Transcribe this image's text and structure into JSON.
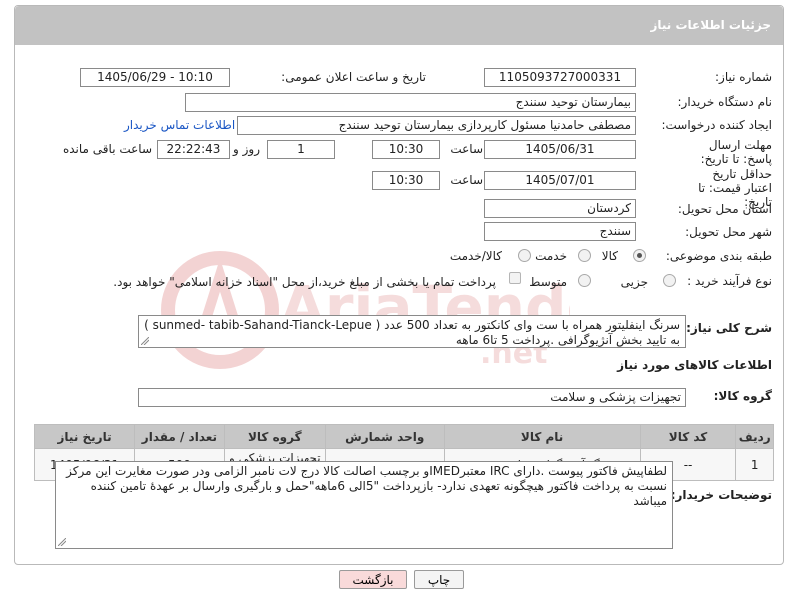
{
  "header": {
    "title": "جزئیات اطلاعات نیاز"
  },
  "fields": {
    "need_number_label": "شماره نیاز:",
    "need_number": "1105093727000331",
    "announce_label": "تاریخ و ساعت اعلان عمومی:",
    "announce_value": "1405/06/29 - 10:10",
    "buyer_org_label": "نام دستگاه خریدار:",
    "buyer_org": "بیمارستان توحید سنندج",
    "creator_label": "ایجاد کننده درخواست:",
    "creator": "مصطفی حامدنیا مسئول کارپردازی بیمارستان توحید سنندج",
    "contact_link": "اطلاعات تماس خریدار",
    "reply_deadline_label": "مهلت ارسال پاسخ: تا تاریخ:",
    "reply_date": "1405/06/31",
    "time_label": "ساعت",
    "reply_time": "10:30",
    "days_value": "1",
    "days_label": "روز و",
    "remaining_time": "22:22:43",
    "remaining_label": "ساعت باقی مانده",
    "price_validity_label": "حداقل تاریخ اعتبار قیمت: تا تاریخ:",
    "validity_date": "1405/07/01",
    "validity_time_label": "ساعت",
    "validity_time": "10:30",
    "province_label": "استان محل تحویل:",
    "province": "کردستان",
    "city_label": "شهر محل تحویل:",
    "city": "سنندج",
    "category_label": "طبقه بندی موضوعی:",
    "category_options": [
      "کالا",
      "خدمت",
      "کالا/خدمت"
    ],
    "category_selected": "کالا",
    "purchase_type_label": "نوع فرآیند خرید :",
    "purchase_options": [
      "جزیی",
      "متوسط"
    ],
    "purchase_selected": "جزیی",
    "payment_note": "پرداخت تمام یا بخشی از مبلغ خرید،از محل \"اسناد خزانه اسلامی\" خواهد بود."
  },
  "description": {
    "label": "شرح کلی نیاز:",
    "text": "سرنگ اینفلیتور همراه با ست وای کانکتور به تعداد 500 عدد ( sunmed- tabib-Sahand-Tianck-Lepue ) به تایید بخش آنژیوگرافی .پرداخت 5 تا6 ماهه"
  },
  "goods_info": {
    "section_title": "اطلاعات کالاهای مورد نیاز",
    "group_label": "گروه کالا:",
    "group_value": "تجهیزات پزشکی و سلامت"
  },
  "table": {
    "headers": [
      "ردیف",
      "کد کالا",
      "نام کالا",
      "واحد شمارش",
      "گروه کالا",
      "تعداد / مقدار",
      "تاریخ نیاز"
    ],
    "rows": [
      [
        "1",
        "--",
        "سرنگ آنژیوگرافی قلبی عروقی",
        "عدد",
        "تجهیزات پزشکی و سلامت",
        "500",
        "1405/06/31"
      ]
    ]
  },
  "buyer_notes": {
    "label": "توضیحات خریدار:",
    "text": "لطفاپیش فاکتور پیوست .دارای IRC معتبرIMEDو برچسب اصالت کالا درج لات نامبر الزامی ودر صورت مغایرت این مرکز نسبت به پرداخت فاکتور هیچگونه تعهدی ندارد- بازپرداخت \"5الی 6ماهه\"حمل و بارگیری وارسال بر عهدۀ تامین کننده میباشد"
  },
  "buttons": {
    "print": "چاپ",
    "back": "بازگشت"
  },
  "watermark": {
    "text": "AriaTender.net"
  },
  "colors": {
    "header_bg": "#c2c2c2",
    "link": "#1a56c4",
    "back_button_bg": "#f9dada",
    "watermark": "#f3d3d3"
  }
}
